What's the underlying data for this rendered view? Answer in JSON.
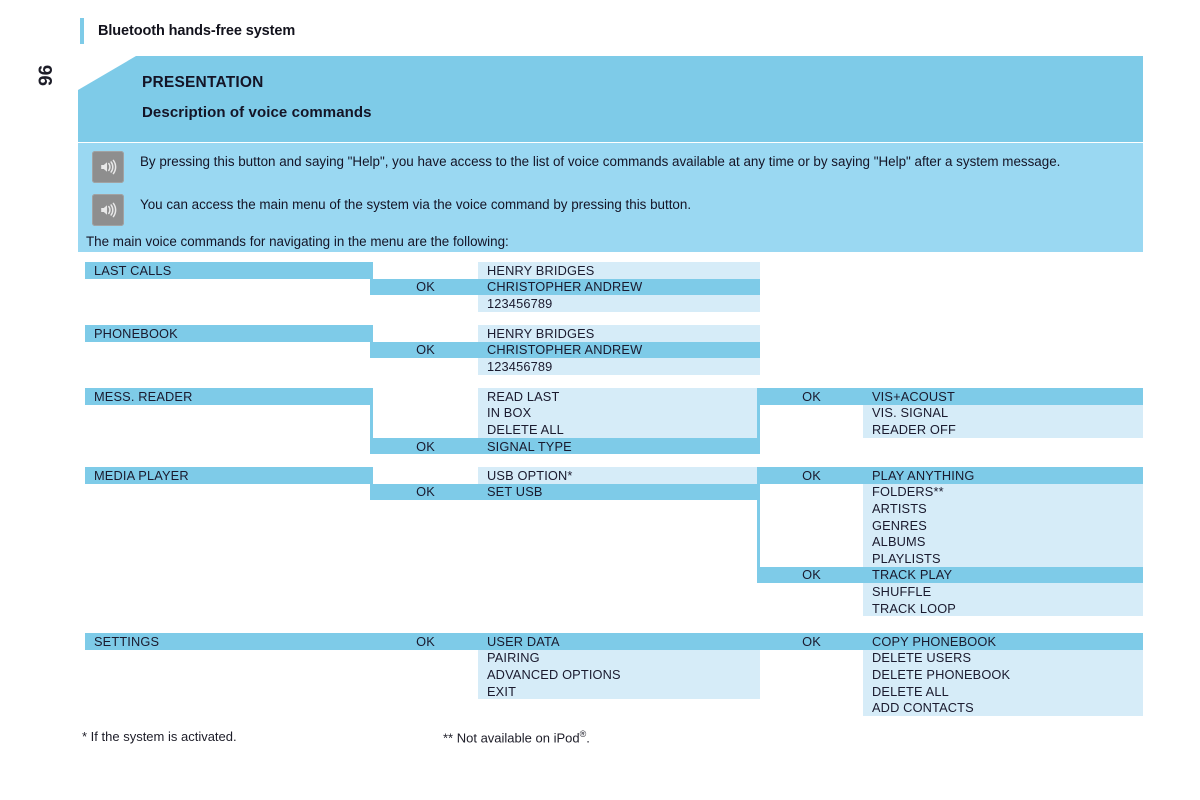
{
  "page": {
    "folio": "96",
    "running_head": "Bluetooth hands-free system",
    "accent_color": "#7ecbe8",
    "panel_color": "#9ad8f2",
    "row_light_color": "#d6ecf8",
    "row_highlight_color": "#7ecbe8"
  },
  "banner": {
    "title": "PRESENTATION",
    "subtitle": "Description of voice commands"
  },
  "intro": {
    "icon_1": "voice-command-button-icon",
    "icon_2": "voice-command-button-icon",
    "paragraph_1": "By pressing this button and saying \"Help\", you have access to the list of voice commands available at any time or by saying \"Help\" after a system message.",
    "paragraph_2": "You can access the main menu of the system via the voice command by pressing this button.",
    "paragraph_3": "The main voice commands for navigating in the menu are the following:"
  },
  "ok_label": "OK",
  "menu_groups": [
    {
      "name": "LAST CALLS",
      "level1": "LAST CALLS",
      "level1_highlight": true,
      "ok_row_index": 1,
      "level2": [
        {
          "label": "HENRY BRIDGES",
          "highlight": false
        },
        {
          "label": "CHRISTOPHER ANDREW",
          "highlight": true
        },
        {
          "label": "123456789",
          "highlight": false
        }
      ],
      "level3": []
    },
    {
      "name": "PHONEBOOK",
      "level1": "PHONEBOOK",
      "level1_highlight": true,
      "ok_row_index": 1,
      "level2": [
        {
          "label": "HENRY BRIDGES",
          "highlight": false
        },
        {
          "label": "CHRISTOPHER ANDREW",
          "highlight": true
        },
        {
          "label": "123456789",
          "highlight": false
        }
      ],
      "level3": []
    },
    {
      "name": "MESS. READER",
      "level1": "MESS. READER",
      "level1_highlight": true,
      "ok_row_index": 3,
      "level2": [
        {
          "label": "READ LAST",
          "highlight": false
        },
        {
          "label": "IN BOX",
          "highlight": false
        },
        {
          "label": "DELETE ALL",
          "highlight": false
        },
        {
          "label": "SIGNAL TYPE",
          "highlight": true
        }
      ],
      "level3_ok_row_index": 0,
      "level3": [
        {
          "label": "VIS+ACOUST",
          "highlight": true
        },
        {
          "label": "VIS. SIGNAL",
          "highlight": false
        },
        {
          "label": "READER OFF",
          "highlight": false
        }
      ]
    },
    {
      "name": "MEDIA PLAYER",
      "level1": "MEDIA PLAYER",
      "level1_highlight": true,
      "ok_row_index": 1,
      "level2": [
        {
          "label": "USB OPTION*",
          "highlight": false
        },
        {
          "label": "SET USB",
          "highlight": true
        }
      ],
      "level3_ok_row_index": 0,
      "level3_ok_row_index_2": 6,
      "level3": [
        {
          "label": "PLAY ANYTHING",
          "highlight": true
        },
        {
          "label": "FOLDERS**",
          "highlight": false
        },
        {
          "label": "ARTISTS",
          "highlight": false
        },
        {
          "label": "GENRES",
          "highlight": false
        },
        {
          "label": "ALBUMS",
          "highlight": false
        },
        {
          "label": "PLAYLISTS",
          "highlight": false
        },
        {
          "label": "TRACK PLAY",
          "highlight": true
        },
        {
          "label": "SHUFFLE",
          "highlight": false
        },
        {
          "label": "TRACK LOOP",
          "highlight": false
        }
      ]
    },
    {
      "name": "SETTINGS",
      "level1": "SETTINGS",
      "level1_highlight": true,
      "ok_row_index": 0,
      "level2": [
        {
          "label": "USER DATA",
          "highlight": true
        },
        {
          "label": "PAIRING",
          "highlight": false
        },
        {
          "label": "ADVANCED OPTIONS",
          "highlight": false
        },
        {
          "label": "EXIT",
          "highlight": false
        }
      ],
      "level3_ok_row_index": 0,
      "level3": [
        {
          "label": "COPY PHONEBOOK",
          "highlight": true
        },
        {
          "label": "DELETE USERS",
          "highlight": false
        },
        {
          "label": "DELETE PHONEBOOK",
          "highlight": false
        },
        {
          "label": "DELETE ALL",
          "highlight": false
        },
        {
          "label": "ADD CONTACTS",
          "highlight": false
        }
      ]
    }
  ],
  "footnotes": {
    "note_1": "* If the system is activated.",
    "note_2_pre": "** Not available on iPod",
    "note_2_sup": "®",
    "note_2_post": "."
  }
}
